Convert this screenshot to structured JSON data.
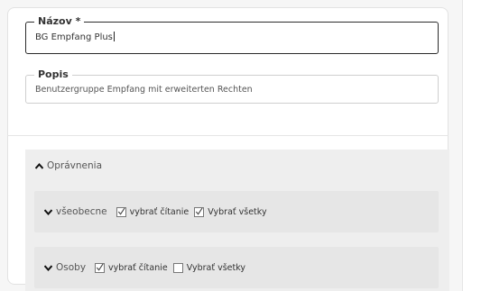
{
  "form": {
    "name_legend": "Názov *",
    "name_value": "BG Empfang Plus",
    "description_legend": "Popis",
    "description_value": "Benutzergruppe Empfang mit erweiterten Rechten"
  },
  "permissions": {
    "header_label": "Oprávnenia",
    "groups": [
      {
        "label": "všeobecne",
        "options": [
          {
            "label": "vybrať čítanie",
            "checked": true
          },
          {
            "label": "Vybrať všetky",
            "checked": true
          }
        ]
      },
      {
        "label": "Osoby",
        "options": [
          {
            "label": "vybrať čítanie",
            "checked": true
          },
          {
            "label": "Vybrať všetky",
            "checked": false
          }
        ]
      }
    ]
  },
  "icons": {
    "chevron_up": "chevron-up-icon",
    "chevron_down": "chevron-down-icon",
    "checkmark": "checkmark-icon"
  }
}
